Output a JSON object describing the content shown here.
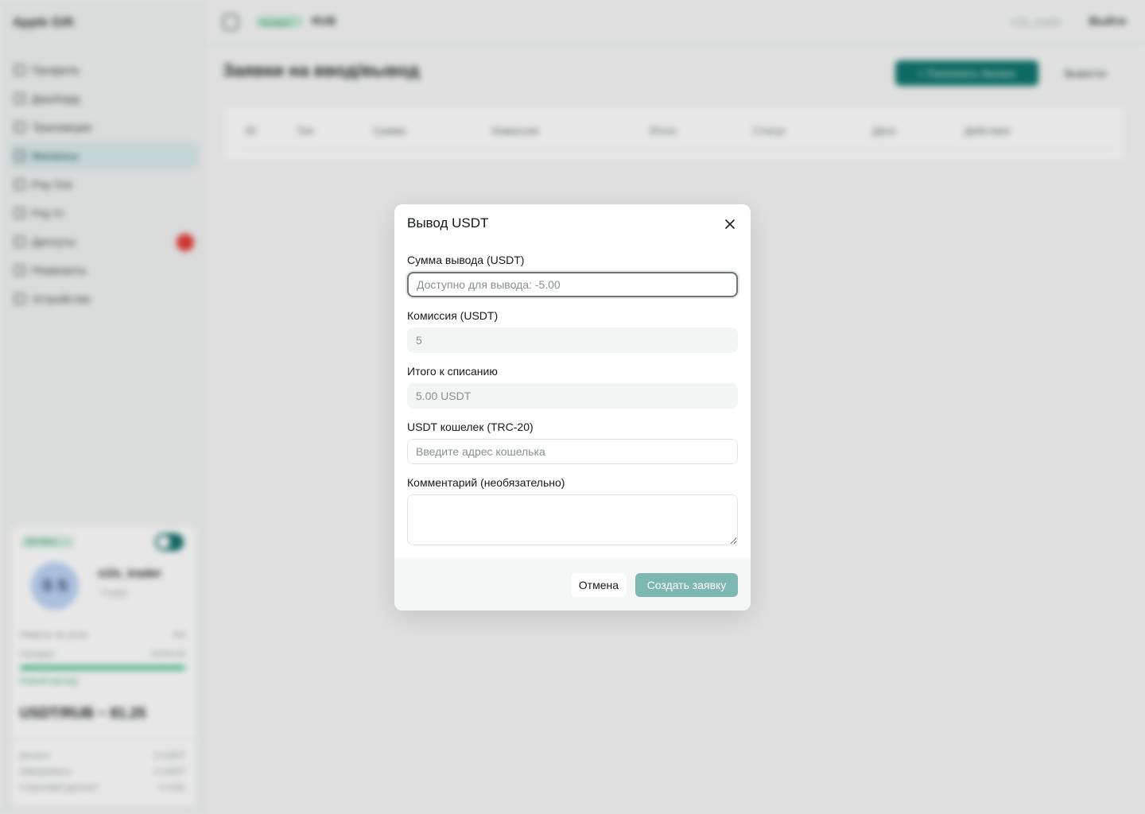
{
  "app": {
    "brand": "Apple Gift",
    "nav": [
      {
        "label": "Профиль",
        "icon": "user-icon"
      },
      {
        "label": "Дашборд",
        "icon": "chart-icon"
      },
      {
        "label": "Транзакции",
        "icon": "list-icon"
      },
      {
        "label": "Финансы",
        "icon": "wallet-icon",
        "active": true
      },
      {
        "label": "Pay Out",
        "icon": "payout-icon"
      },
      {
        "label": "Pay In",
        "icon": "payin-icon"
      },
      {
        "label": "Диспуты",
        "icon": "dispute-icon",
        "badge": true
      },
      {
        "label": "Реквизиты",
        "icon": "card-icon"
      },
      {
        "label": "Устройства",
        "icon": "device-icon"
      }
    ],
    "topbar": {
      "status_badge": "Активен",
      "currency": "RUB",
      "username": "s1ls_trader",
      "logout": "Выйти"
    },
    "page_title": "Заявки на ввод/вывод",
    "actions": {
      "topup": "+ Пополнить баланс",
      "withdraw": "Вывести"
    },
    "table_headers": [
      "ID",
      "Тип",
      "Сумма",
      "Комиссия",
      "Итого",
      "Статус",
      "Дата",
      "Действия"
    ],
    "profile": {
      "status": "Активен",
      "initials": "S S",
      "name": "s1ls_trader",
      "role": "Trader",
      "rows": [
        {
          "label": "Лимиты на сутки",
          "value": "0/0"
        },
        {
          "label": "Сегодня",
          "value": "0/100.00"
        }
      ],
      "link": "Новый расход",
      "rate": "USDT/RUB ~ 81.25",
      "balances": [
        {
          "label": "Баланс",
          "value": "0 USDT"
        },
        {
          "label": "Заморожено",
          "value": "0 USDT"
        },
        {
          "label": "Страховой депозит",
          "value": "0 USD"
        }
      ]
    }
  },
  "modal": {
    "title": "Вывод USDT",
    "amount": {
      "label": "Сумма вывода (USDT)",
      "placeholder": "Доступно для вывода: -5.00"
    },
    "fee": {
      "label": "Комиссия (USDT)",
      "value": "5"
    },
    "total": {
      "label": "Итого к списанию",
      "value": "5.00 USDT"
    },
    "wallet": {
      "label": "USDT кошелек (TRC-20)",
      "placeholder": "Введите адрес кошелька"
    },
    "comment": {
      "label": "Комментарий (необязательно)"
    },
    "cancel_label": "Отмена",
    "submit_label": "Создать заявку"
  },
  "colors": {
    "accent": "#0e756c",
    "submit_disabled": "#7db7b1",
    "danger": "#e53935"
  }
}
